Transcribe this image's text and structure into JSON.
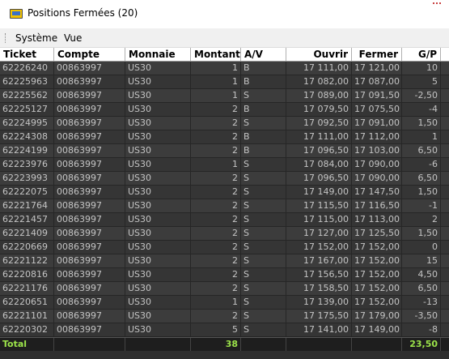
{
  "window": {
    "title": "Positions Fermées (20)"
  },
  "menu": {
    "items": [
      "Système",
      "Vue"
    ]
  },
  "table": {
    "columns": [
      "Ticket",
      "Compte",
      "Monnaie",
      "Montant",
      "A/V",
      "Ouvrir",
      "Fermer",
      "G/P"
    ],
    "rows": [
      [
        "62226240",
        "00863997",
        "US30",
        "1",
        "B",
        "17 111,00",
        "17 121,00",
        "10"
      ],
      [
        "62225963",
        "00863997",
        "US30",
        "1",
        "B",
        "17 082,00",
        "17 087,00",
        "5"
      ],
      [
        "62225562",
        "00863997",
        "US30",
        "1",
        "S",
        "17 089,00",
        "17 091,50",
        "-2,50"
      ],
      [
        "62225127",
        "00863997",
        "US30",
        "2",
        "B",
        "17 079,50",
        "17 075,50",
        "-4"
      ],
      [
        "62224995",
        "00863997",
        "US30",
        "2",
        "S",
        "17 092,50",
        "17 091,00",
        "1,50"
      ],
      [
        "62224308",
        "00863997",
        "US30",
        "2",
        "B",
        "17 111,00",
        "17 112,00",
        "1"
      ],
      [
        "62224199",
        "00863997",
        "US30",
        "2",
        "B",
        "17 096,50",
        "17 103,00",
        "6,50"
      ],
      [
        "62223976",
        "00863997",
        "US30",
        "1",
        "S",
        "17 084,00",
        "17 090,00",
        "-6"
      ],
      [
        "62223993",
        "00863997",
        "US30",
        "2",
        "S",
        "17 096,50",
        "17 090,00",
        "6,50"
      ],
      [
        "62222075",
        "00863997",
        "US30",
        "2",
        "S",
        "17 149,00",
        "17 147,50",
        "1,50"
      ],
      [
        "62221764",
        "00863997",
        "US30",
        "2",
        "S",
        "17 115,50",
        "17 116,50",
        "-1"
      ],
      [
        "62221457",
        "00863997",
        "US30",
        "2",
        "S",
        "17 115,00",
        "17 113,00",
        "2"
      ],
      [
        "62221409",
        "00863997",
        "US30",
        "2",
        "S",
        "17 127,00",
        "17 125,50",
        "1,50"
      ],
      [
        "62220669",
        "00863997",
        "US30",
        "2",
        "S",
        "17 152,00",
        "17 152,00",
        "0"
      ],
      [
        "62221122",
        "00863997",
        "US30",
        "2",
        "S",
        "17 167,00",
        "17 152,00",
        "15"
      ],
      [
        "62220816",
        "00863997",
        "US30",
        "2",
        "S",
        "17 156,50",
        "17 152,00",
        "4,50"
      ],
      [
        "62221176",
        "00863997",
        "US30",
        "2",
        "S",
        "17 158,50",
        "17 152,00",
        "6,50"
      ],
      [
        "62220651",
        "00863997",
        "US30",
        "1",
        "S",
        "17 139,00",
        "17 152,00",
        "-13"
      ],
      [
        "62221101",
        "00863997",
        "US30",
        "2",
        "S",
        "17 175,50",
        "17 179,00",
        "-3,50"
      ],
      [
        "62220302",
        "00863997",
        "US30",
        "5",
        "S",
        "17 141,00",
        "17 149,00",
        "-8"
      ]
    ],
    "total": {
      "label": "Total",
      "amount": "38",
      "pnl": "23,50"
    }
  },
  "colors": {
    "row_bg": "#3c3c3c",
    "row_text": "#c4c4c4",
    "total_text": "#9ce44a",
    "header_bg": "#ffffff"
  },
  "icons": {
    "window": "window-icon"
  }
}
